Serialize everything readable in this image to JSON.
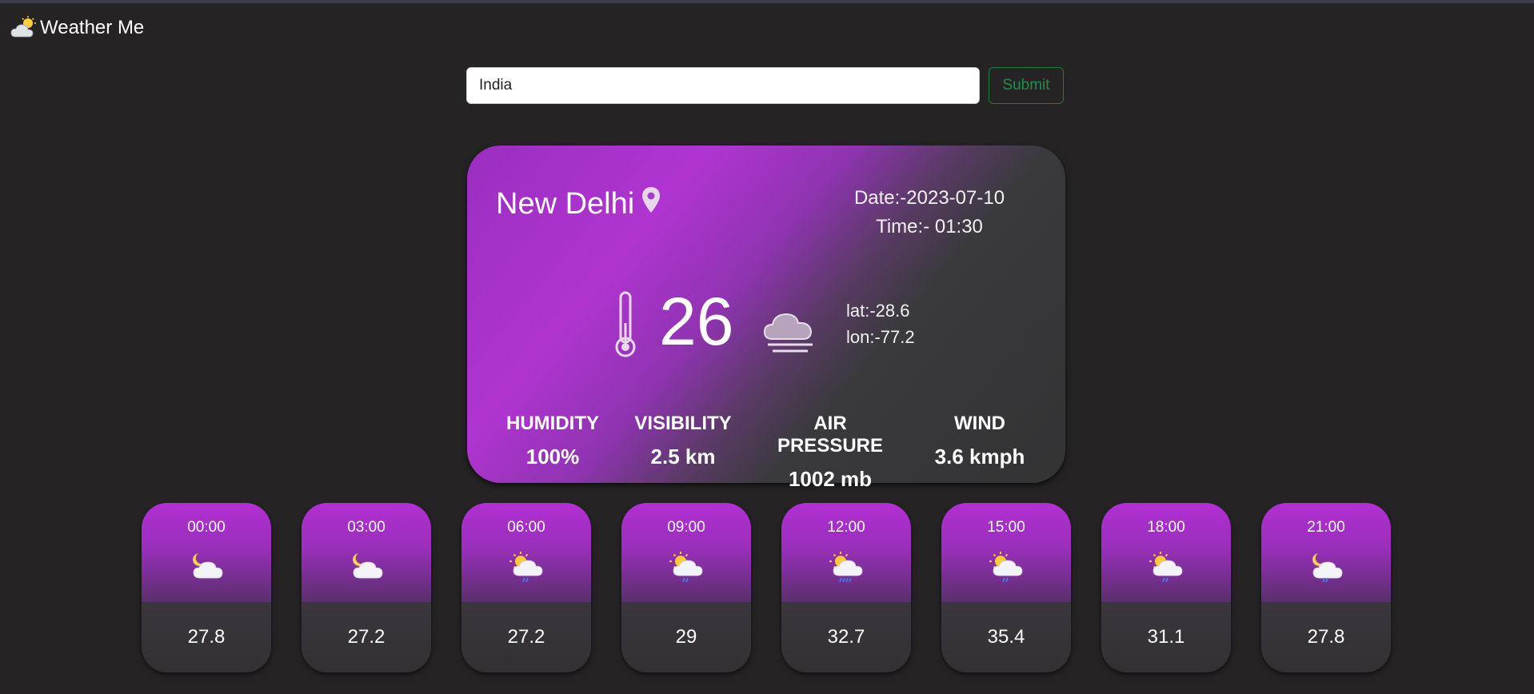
{
  "app": {
    "title": "Weather Me",
    "logo_icon": "sun-behind-cloud-icon"
  },
  "search": {
    "value": "India",
    "placeholder": "",
    "submit_label": "Submit"
  },
  "colors": {
    "accent": "#b034d1",
    "background": "#252324",
    "submit": "#1e8f4c"
  },
  "current": {
    "city": "New Delhi",
    "location_icon": "map-pin-icon",
    "date": "Date:-2023-07-10",
    "time": "Time:- 01:30",
    "temperature": "26",
    "thermometer_icon": "thermometer-icon",
    "condition_icon": "fog-cloud-icon",
    "lat": "lat:-28.6",
    "lon": "lon:-77.2",
    "stats": [
      {
        "label": "HUMIDITY",
        "value": "100%"
      },
      {
        "label": "VISIBILITY",
        "value": "2.5 km"
      },
      {
        "label": "AIR PRESSURE",
        "value": "1002 mb"
      },
      {
        "label": "WIND",
        "value": "3.6 kmph"
      }
    ]
  },
  "forecast": [
    {
      "time": "00:00",
      "temp": "27.8",
      "icon": "moon-cloud-icon"
    },
    {
      "time": "03:00",
      "temp": "27.2",
      "icon": "moon-cloud-icon"
    },
    {
      "time": "06:00",
      "temp": "27.2",
      "icon": "sun-cloud-rain-icon"
    },
    {
      "time": "09:00",
      "temp": "29",
      "icon": "sun-cloud-rain-icon"
    },
    {
      "time": "12:00",
      "temp": "32.7",
      "icon": "sun-cloud-heavy-rain-icon"
    },
    {
      "time": "15:00",
      "temp": "35.4",
      "icon": "sun-cloud-rain-icon"
    },
    {
      "time": "18:00",
      "temp": "31.1",
      "icon": "sun-cloud-rain-icon"
    },
    {
      "time": "21:00",
      "temp": "27.8",
      "icon": "moon-cloud-rain-icon"
    }
  ]
}
